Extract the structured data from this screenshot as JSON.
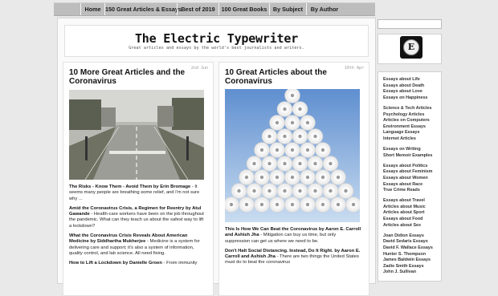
{
  "nav": [
    "Home",
    "150 Great Articles & Essays",
    "Best of 2019",
    "100 Great Books",
    "By Subject",
    "By Author"
  ],
  "site": {
    "title": "The Electric Typewriter",
    "tagline": "Great articles and essays by the world's best journalists and writers."
  },
  "posts": [
    {
      "date": "2nd Jun",
      "title": "10 More Great Articles and the Coronavirus",
      "image_alt": "Empty city street",
      "entries": [
        {
          "title": "The Risks - Know Them - Avoid Them by Erin Bromage",
          "text": " - It seems many people are breathing some relief, and I'm not sure why ..."
        },
        {
          "title": "Amid the Coronavirus Crisis, a Regimen for Reentry by Atul Gawande",
          "text": " - Health-care workers have been on the job throughout the pandemic. What can they teach us about the safest way to lift a lockdown?"
        },
        {
          "title": "What the Coronavirus Crisis Reveals About American Medicine by Siddhartha Mukherjee",
          "text": " - Medicine is a system for delivering care and support; it's also a system of information, quality control, and lab science. All need fixing."
        },
        {
          "title": "How to Lift a Lockdown by Danielle Groen",
          "text": " - From immunity"
        }
      ]
    },
    {
      "date": "10th Apr",
      "title": "10 Great Articles about the Coronavirus",
      "image_alt": "Pyramid of toilet paper rolls",
      "entries": [
        {
          "title": "This Is How We Can Beat the Coronavirus by Aaron E. Carroll and Ashish Jha",
          "text": " - Mitigation can buy us time, but only suppression can get us where we need to be."
        },
        {
          "title": "Don't Halt Social Distancing. Instead, Do It Right. by Aaron E. Carroll and Ashish Jha",
          "text": " - There are two things the United States must do to beat the coronavirus"
        }
      ]
    }
  ],
  "sidebar": {
    "logo_letter": "E",
    "groups": [
      [
        "Essays about Life",
        "Essays about Death",
        "Essays about Love",
        "Essays on Happiness"
      ],
      [
        "Science & Tech Articles",
        "Psychology Articles",
        "Articles on Computers",
        "Environment Essays",
        "Language Essays",
        "Internet Articles"
      ],
      [
        "Essays on Writing",
        "Short Memoir Examples"
      ],
      [
        "Essays about Politics",
        "Essays about Feminism",
        "Essays about Women",
        "Essays about Race",
        "True Crime Reads"
      ],
      [
        "Essays about Travel",
        "Articles about Music",
        "Articles about Sport",
        "Essays about Food",
        "Articles about Sex"
      ],
      [
        "Joan Didion Essays",
        "David Sedaris Essays",
        "David F. Wallace Essays",
        "Hunter S. Thompson",
        "James Baldwin Essays",
        "Zadie Smith Essays",
        "John J. Sullivan"
      ]
    ]
  }
}
